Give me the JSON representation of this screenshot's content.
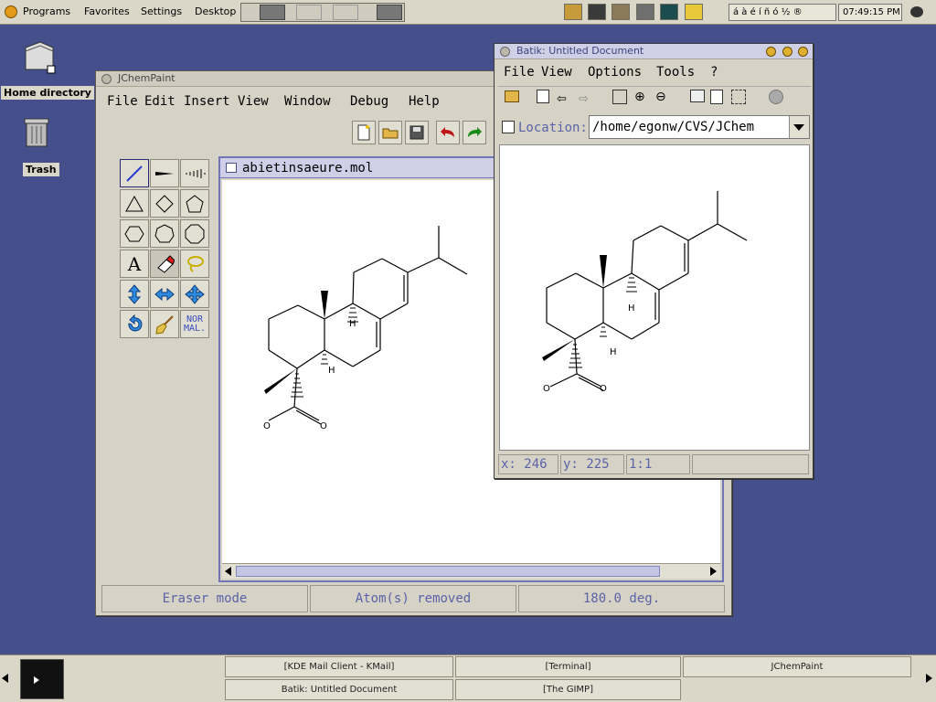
{
  "top_panel": {
    "menus": [
      "Programs",
      "Favorites",
      "Settings",
      "Desktop"
    ],
    "keyboard_chars": "á à é í ñ ó ½ ®",
    "clock": "07:49:15 PM"
  },
  "desktop": {
    "home_label": "Home directory",
    "trash_label": "Trash"
  },
  "jchempaint": {
    "title": "JChemPaint",
    "menu": [
      "File",
      "Edit",
      "Insert",
      "View",
      "Window",
      "Debug",
      "Help"
    ],
    "doc_title": "abietinsaeure.mol",
    "tool_text_a": "A",
    "tool_normal": "NOR\nMAL.",
    "status": [
      "Eraser mode",
      "Atom(s) removed",
      "180.0 deg."
    ],
    "atom_h1": "H",
    "atom_h2": "H",
    "atom_o1": "O",
    "atom_o2": "O"
  },
  "batik": {
    "title": "Batik: Untitled Document",
    "menu": [
      "File",
      "View",
      "Options",
      "Tools",
      "?"
    ],
    "location_label": "Location:",
    "location_value": "/home/egonw/CVS/JChem",
    "status": [
      "x: 246",
      "y: 225",
      "1:1",
      ""
    ],
    "atom_h1": "H",
    "atom_h2": "H",
    "atom_o1": "O",
    "atom_o2": "O"
  },
  "taskbar": {
    "tasks": [
      "[KDE Mail Client - KMail]",
      "[Terminal]",
      "JChemPaint",
      "Batik: Untitled Document",
      "[The GIMP]"
    ]
  },
  "colors": {
    "desktop": "#454f8b",
    "panel": "#dad7c9",
    "accent_text": "#5a63a8"
  }
}
